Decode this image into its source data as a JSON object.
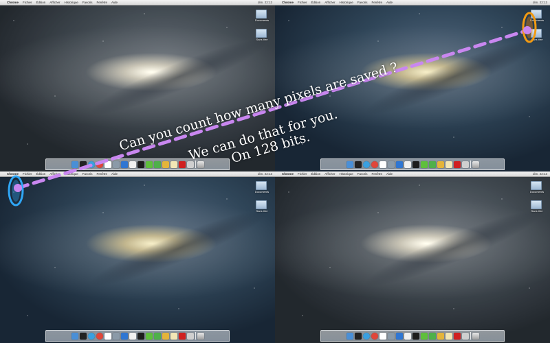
{
  "menubar": {
    "apple_glyph": "",
    "app_name": "Chrome",
    "items": [
      "Fichier",
      "Édition",
      "Afficher",
      "Historique",
      "Favoris",
      "Fenêtre",
      "Aide"
    ],
    "clock": "dim. 22:13"
  },
  "desktop_icons": [
    "Documents",
    "Sans titre"
  ],
  "dock_icons": [
    {
      "name": "finder-icon",
      "color": "#4a8fd6"
    },
    {
      "name": "terminal-icon",
      "color": "#222222"
    },
    {
      "name": "safari-icon",
      "color": "#3aa0e0"
    },
    {
      "name": "chrome-icon",
      "color": "#e0463a"
    },
    {
      "name": "calendar-icon",
      "color": "#ffffff"
    },
    {
      "name": "preview-icon",
      "color": "#8b9aa8"
    },
    {
      "name": "app-store-icon",
      "color": "#2f76d2"
    },
    {
      "name": "textedit-icon",
      "color": "#f0f0f0"
    },
    {
      "name": "activity-monitor-icon",
      "color": "#1d1d1d"
    },
    {
      "name": "disk-utility-icon",
      "color": "#5fbf3c"
    },
    {
      "name": "games-icon",
      "color": "#4fb04a"
    },
    {
      "name": "keychain-icon",
      "color": "#e4b43a"
    },
    {
      "name": "archive-icon",
      "color": "#f2e6b5"
    },
    {
      "name": "acrobat-icon",
      "color": "#d02020"
    },
    {
      "name": "documents-icon",
      "color": "#cfcfcf"
    }
  ],
  "caption": {
    "line1": "Can you count how many pixels are saved ?",
    "line2": "We can do that for you.",
    "line3": "On 128 bits."
  },
  "colors": {
    "dashed_line": "#c987f0",
    "portal_orange": "#f29a12",
    "portal_blue": "#2fa6f5"
  }
}
